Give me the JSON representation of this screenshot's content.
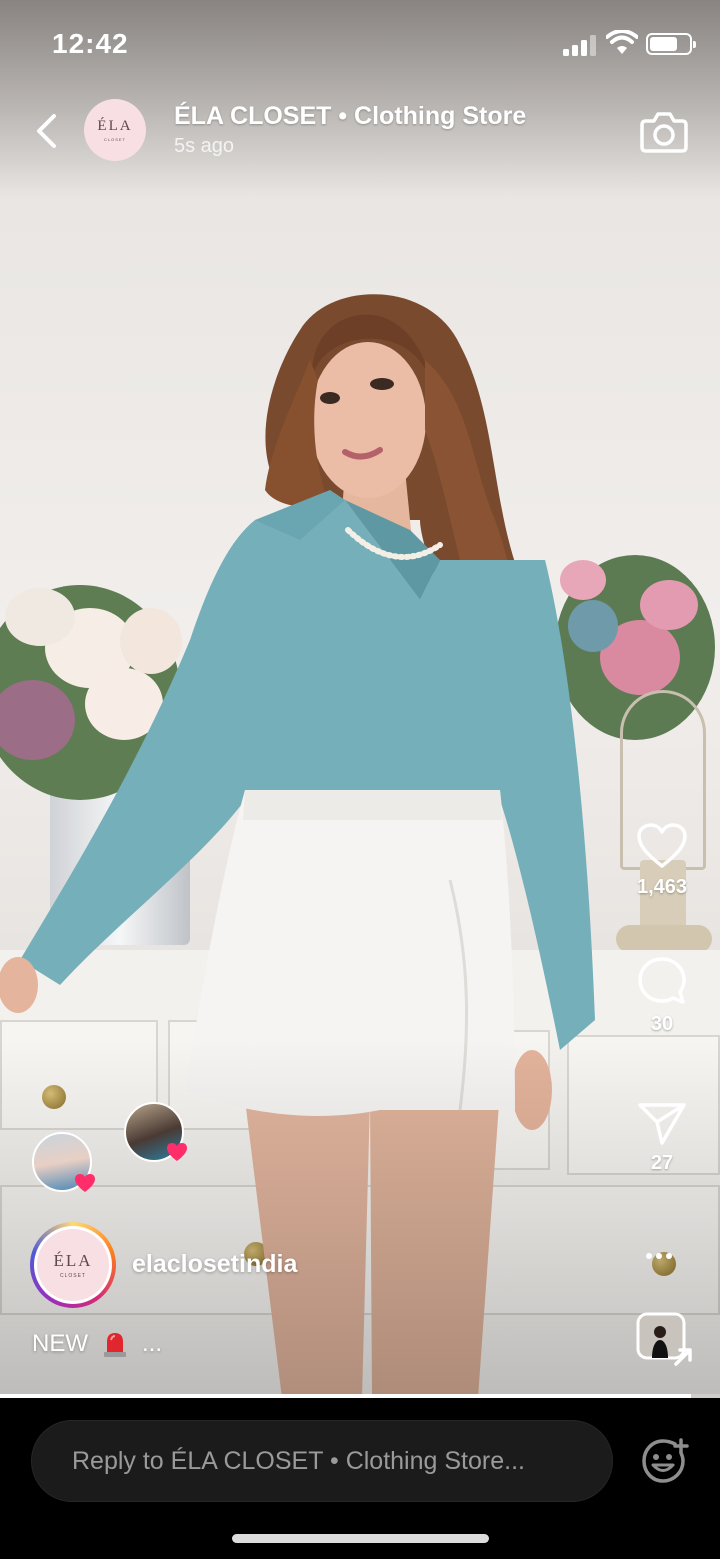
{
  "status_bar": {
    "time": "12:42",
    "battery_level": 0.7
  },
  "story_header": {
    "account_name": "ÉLA CLOSET • Clothing Store",
    "time_ago": "5s ago",
    "avatar_text": "ÉLA",
    "avatar_subtext": "CLOSET"
  },
  "actions": {
    "like_count": "1,463",
    "comment_count": "30",
    "share_count": "27"
  },
  "post": {
    "username": "elaclosetindia",
    "avatar_text": "ÉLA",
    "avatar_subtext": "CLOSET",
    "caption_text": "NEW",
    "caption_more": "..."
  },
  "progress_level": 0.96,
  "reply": {
    "placeholder": "Reply to ÉLA CLOSET • Clothing Store..."
  },
  "colors": {
    "accent_heart": "#ff2e6a",
    "shirt": "#72aeb9",
    "skirt": "#f4f4f2"
  },
  "icons": [
    "back-arrow-icon",
    "camera-icon",
    "heart-icon",
    "comment-icon",
    "send-icon",
    "more-dots-icon",
    "remix-icon",
    "emoji-add-icon",
    "siren-emoji-icon"
  ]
}
